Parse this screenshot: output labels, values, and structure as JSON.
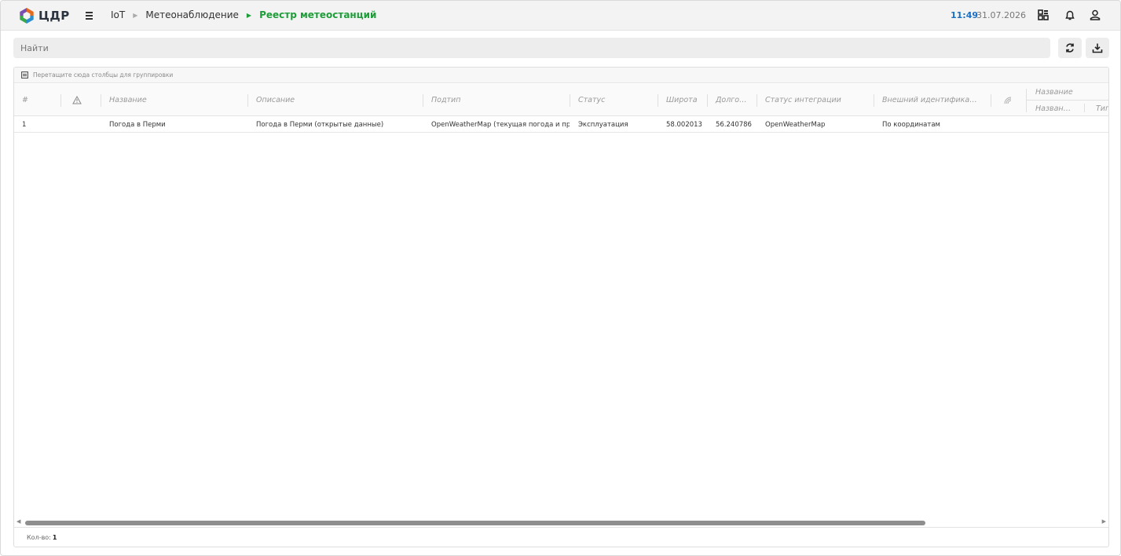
{
  "app": {
    "logo_text": "ЦДР"
  },
  "breadcrumb": [
    "IoT",
    "Метеонаблюдение",
    "Реестр метеостанций"
  ],
  "clock": {
    "time": "11:49",
    "date": "31.07.2026"
  },
  "search": {
    "placeholder": "Найти",
    "value": ""
  },
  "grid": {
    "group_hint": "Перетащите сюда столбцы для группировки",
    "columns": [
      "#",
      "",
      "Название",
      "Описание",
      "Подтип",
      "Статус",
      "Широта",
      "Долго…",
      "Статус интеграции",
      "Внешний идентифика…",
      ""
    ],
    "group_header": "Название",
    "sub_columns": [
      "Назван…",
      "Тип"
    ],
    "rows": [
      [
        "1",
        "",
        "Погода в Перми",
        "Погода в Перми (открытые данные)",
        "OpenWeatherMap (текущая погода и прс",
        "Эксплуатация",
        "58.002013",
        "56.240786",
        "OpenWeatherMap",
        "По координатам"
      ]
    ]
  },
  "footer": {
    "count_label": "Кол-во:",
    "count_value": "1"
  },
  "colors": {
    "accent_green": "#1f9d3a",
    "time_blue": "#1a6fc2"
  }
}
